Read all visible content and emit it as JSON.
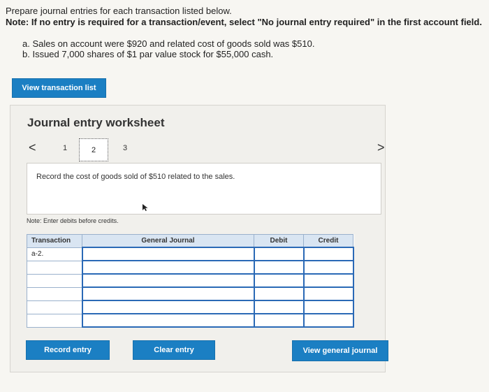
{
  "instructions": {
    "line1": "Prepare journal entries for each transaction listed below.",
    "note": "Note: If no entry is required for a transaction/event, select \"No journal entry required\" in the first account field."
  },
  "transactions": [
    "a. Sales on account were $920 and related cost of goods sold was $510.",
    "b. Issued 7,000 shares of $1 par value stock for $55,000 cash."
  ],
  "view_transaction_list_label": "View transaction list",
  "worksheet": {
    "title": "Journal entry worksheet",
    "pager": {
      "prev": "<",
      "next": ">",
      "pages": [
        "1",
        "2",
        "3"
      ],
      "current": "2"
    },
    "description": "Record the cost of goods sold of $510 related to the sales.",
    "note": "Note: Enter debits before credits.",
    "table": {
      "headers": [
        "Transaction",
        "General Journal",
        "Debit",
        "Credit"
      ],
      "rows": [
        [
          "a-2.",
          "",
          "",
          ""
        ],
        [
          "",
          "",
          "",
          ""
        ],
        [
          "",
          "",
          "",
          ""
        ],
        [
          "",
          "",
          "",
          ""
        ],
        [
          "",
          "",
          "",
          ""
        ],
        [
          "",
          "",
          "",
          ""
        ]
      ]
    },
    "buttons": {
      "record": "Record entry",
      "clear": "Clear entry",
      "view_journal": "View general journal"
    }
  },
  "colors": {
    "accent": "#1b7fc3",
    "header_bg": "#d9e5f2",
    "field_border": "#2a69b6"
  }
}
